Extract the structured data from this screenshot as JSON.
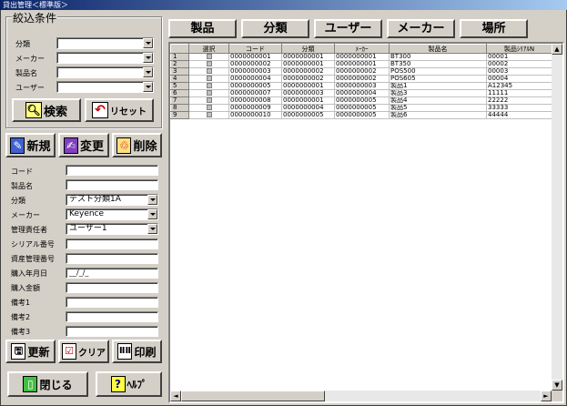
{
  "window": {
    "title": "貸出管理＜標準版＞"
  },
  "filter": {
    "legend": "絞込条件",
    "fields": [
      {
        "label": "分類",
        "value": ""
      },
      {
        "label": "メーカー",
        "value": ""
      },
      {
        "label": "製品名",
        "value": ""
      },
      {
        "label": "ユーザー",
        "value": ""
      }
    ],
    "search_label": "検索",
    "reset_label": "リセット"
  },
  "actions": {
    "new_label": "新規",
    "edit_label": "変更",
    "delete_label": "削除"
  },
  "form": {
    "code": {
      "label": "コード",
      "value": ""
    },
    "product": {
      "label": "製品名",
      "value": ""
    },
    "category": {
      "label": "分類",
      "value": "テスト分類1A"
    },
    "maker": {
      "label": "メーカー",
      "value": "Keyence"
    },
    "manager": {
      "label": "管理責任者",
      "value": "ユーザー1"
    },
    "serial": {
      "label": "シリアル番号",
      "value": ""
    },
    "asset": {
      "label": "資産管理番号",
      "value": ""
    },
    "purchase_date": {
      "label": "購入年月日",
      "value": "__/_/_"
    },
    "price": {
      "label": "購入金額",
      "value": ""
    },
    "note1": {
      "label": "備考1",
      "value": ""
    },
    "note2": {
      "label": "備考2",
      "value": ""
    },
    "note3": {
      "label": "備考3",
      "value": ""
    }
  },
  "bottom": {
    "update_label": "更新",
    "clear_label": "クリア",
    "print_label": "印刷",
    "close_label": "閉じる",
    "help_label": "ﾍﾙﾌﾟ"
  },
  "tabs": [
    "製品",
    "分類",
    "ユーザー",
    "メーカー",
    "場所"
  ],
  "table": {
    "columns": [
      "",
      "選択",
      "コード",
      "分類",
      "ﾒｰｶｰ",
      "製品名",
      "製品ｼﾘｱﾙN"
    ],
    "rows": [
      [
        "1",
        "",
        "0000000001",
        "0000000001",
        "0000000001",
        "BT300",
        "00001"
      ],
      [
        "2",
        "",
        "0000000002",
        "0000000001",
        "0000000001",
        "BT350",
        "00002"
      ],
      [
        "3",
        "",
        "0000000003",
        "0000000002",
        "0000000002",
        "POS500",
        "00003"
      ],
      [
        "4",
        "",
        "0000000004",
        "0000000002",
        "0000000002",
        "POS605",
        "00004"
      ],
      [
        "5",
        "",
        "0000000005",
        "0000000001",
        "0000000003",
        "製品1",
        "A12345"
      ],
      [
        "6",
        "",
        "0000000007",
        "0000000003",
        "0000000004",
        "製品3",
        "11111"
      ],
      [
        "7",
        "",
        "0000000008",
        "0000000001",
        "0000000005",
        "製品4",
        "22222"
      ],
      [
        "8",
        "",
        "0000000009",
        "0000000004",
        "0000000005",
        "製品5",
        "33333"
      ],
      [
        "9",
        "",
        "0000000010",
        "0000000005",
        "0000000005",
        "製品6",
        "44444"
      ]
    ]
  }
}
